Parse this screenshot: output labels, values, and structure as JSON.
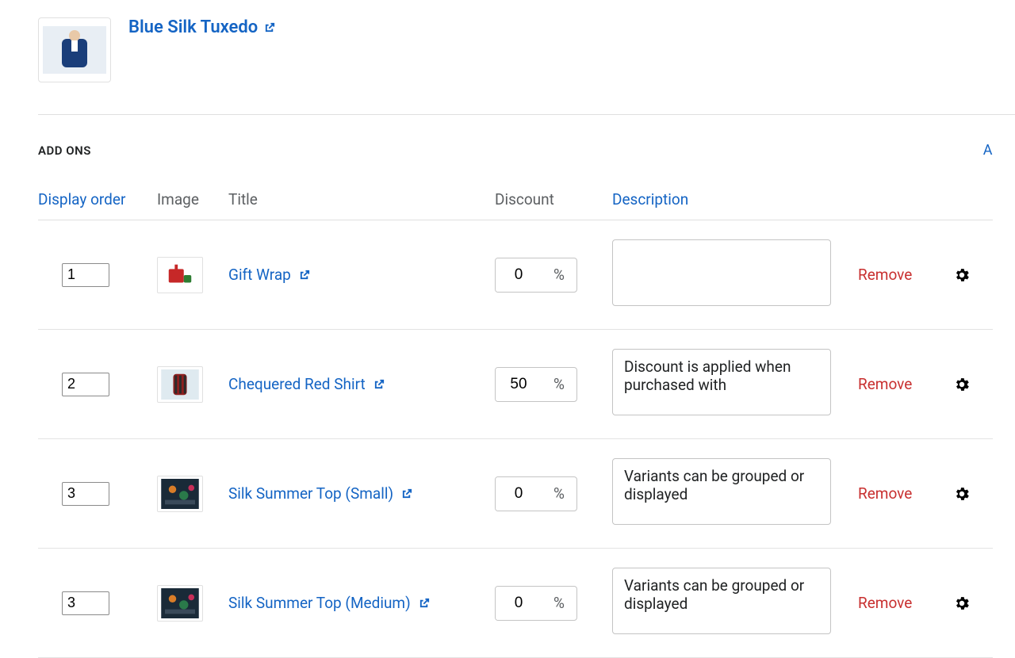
{
  "product": {
    "title": "Blue Silk Tuxedo"
  },
  "section": {
    "heading": "ADD ONS",
    "right_action": "A"
  },
  "table": {
    "headers": {
      "display_order": "Display order",
      "image": "Image",
      "title": "Title",
      "discount": "Discount",
      "description": "Description"
    },
    "percent_suffix": "%",
    "remove_label": "Remove",
    "rows": [
      {
        "order": "1",
        "title": "Gift Wrap",
        "discount": "0",
        "description": ""
      },
      {
        "order": "2",
        "title": "Chequered Red Shirt",
        "discount": "50",
        "description": "Discount is applied when purchased with"
      },
      {
        "order": "3",
        "title": "Silk Summer Top (Small)",
        "discount": "0",
        "description": "Variants can be grouped or displayed"
      },
      {
        "order": "3",
        "title": "Silk Summer Top (Medium)",
        "discount": "0",
        "description": "Variants can be grouped or displayed"
      }
    ]
  }
}
